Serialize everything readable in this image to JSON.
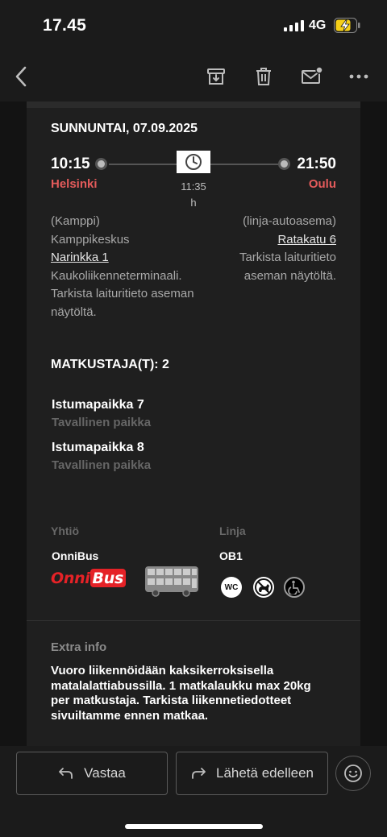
{
  "status_bar": {
    "time": "17.45",
    "network": "4G"
  },
  "toolbar": {
    "icons": [
      "back-icon",
      "archive-icon",
      "trash-icon",
      "mail-unread-icon",
      "more-icon"
    ]
  },
  "trip": {
    "date": "SUNNUNTAI, 07.09.2025",
    "departure": {
      "time": "10:15",
      "city": "Helsinki",
      "line1": "(Kamppi)",
      "line2": "Kamppikeskus",
      "link": "Narinkka 1",
      "note": "Kaukoliikenneterminaali. Tarkista laituritieto aseman näytöltä."
    },
    "arrival": {
      "time": "21:50",
      "city": "Oulu",
      "line1": "(linja-autoasema)",
      "link": "Ratakatu 6",
      "note": "Tarkista laituritieto aseman näytöltä."
    },
    "duration_value": "11:35",
    "duration_unit": "h"
  },
  "passengers": {
    "title": "MATKUSTAJA(T): 2",
    "seats": [
      {
        "name": "Istumapaikka 7",
        "type": "Tavallinen paikka"
      },
      {
        "name": "Istumapaikka 8",
        "type": "Tavallinen paikka"
      }
    ]
  },
  "company": {
    "label": "Yhtiö",
    "value": "OnniBus",
    "logo_text": "Onni",
    "logo_text_box": "Bus",
    "brand_color": "#e52227"
  },
  "line": {
    "label": "Linja",
    "value": "OB1",
    "amenities": [
      "wc-icon",
      "no-pets-icon",
      "wheelchair-icon"
    ],
    "wc_text": "WC"
  },
  "extra": {
    "title": "Extra info",
    "text": "Vuoro liikennöidään kaksikerroksisella matalalattiabussilla. 1 matkalaukku max 20kg per matkustaja. Tarkista liikennetiedotteet sivuiltamme ennen matkaa."
  },
  "actions": {
    "reply_label": "Vastaa",
    "forward_label": "Lähetä edelleen"
  }
}
